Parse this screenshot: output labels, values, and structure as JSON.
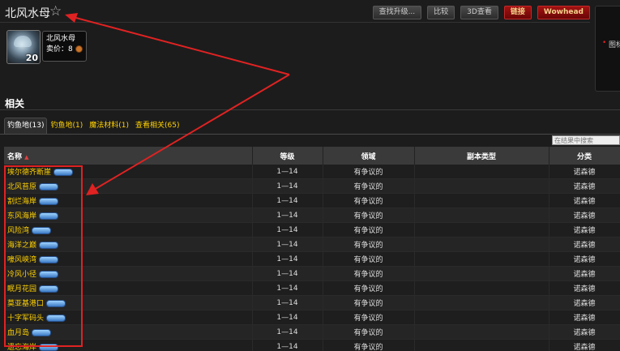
{
  "header": {
    "title": "北风水母",
    "toolbar": [
      {
        "label": "查找升级..."
      },
      {
        "label": "比较"
      },
      {
        "label": "3D查看"
      },
      {
        "label": "链接"
      },
      {
        "label": "Wowhead"
      }
    ]
  },
  "item": {
    "name": "北风水母",
    "count": "20",
    "price_label": "卖价：",
    "price_value": "8"
  },
  "side_panel": {
    "text": "图标"
  },
  "section": {
    "title": "相关",
    "tabs": [
      {
        "label": "钓鱼地(13)",
        "active": true
      },
      {
        "label": "钓鱼地(1)"
      },
      {
        "label": "魔法材料(1)"
      },
      {
        "label": "查看相关(65)"
      }
    ]
  },
  "search": {
    "placeholder": "在结果中搜索"
  },
  "table": {
    "columns": [
      "名称",
      "等级",
      "领域",
      "副本类型",
      "分类"
    ],
    "rows": [
      {
        "name": "埃尔德齐断崖",
        "level": "1—14",
        "realm": "有争议的",
        "instance": "",
        "category": "诺森德"
      },
      {
        "name": "北风苔原",
        "level": "1—14",
        "realm": "有争议的",
        "instance": "",
        "category": "诺森德"
      },
      {
        "name": "割烂海岸",
        "level": "1—14",
        "realm": "有争议的",
        "instance": "",
        "category": "诺森德"
      },
      {
        "name": "东风海岸",
        "level": "1—14",
        "realm": "有争议的",
        "instance": "",
        "category": "诺森德"
      },
      {
        "name": "风险湾",
        "level": "1—14",
        "realm": "有争议的",
        "instance": "",
        "category": "诺森德"
      },
      {
        "name": "海洋之巅",
        "level": "1—14",
        "realm": "有争议的",
        "instance": "",
        "category": "诺森德"
      },
      {
        "name": "嚎风峡湾",
        "level": "1—14",
        "realm": "有争议的",
        "instance": "",
        "category": "诺森德"
      },
      {
        "name": "冷风小径",
        "level": "1—14",
        "realm": "有争议的",
        "instance": "",
        "category": "诺森德"
      },
      {
        "name": "眠月花园",
        "level": "1—14",
        "realm": "有争议的",
        "instance": "",
        "category": "诺森德"
      },
      {
        "name": "莫亚基港口",
        "level": "1—14",
        "realm": "有争议的",
        "instance": "",
        "category": "诺森德"
      },
      {
        "name": "十字军码头",
        "level": "1—14",
        "realm": "有争议的",
        "instance": "",
        "category": "诺森德"
      },
      {
        "name": "血月岛",
        "level": "1—14",
        "realm": "有争议的",
        "instance": "",
        "category": "诺森德"
      },
      {
        "name": "遗忘海岸",
        "level": "1—14",
        "realm": "有争议的",
        "instance": "",
        "category": "诺森德"
      }
    ]
  },
  "colors": {
    "background": "#1c1c1c",
    "link_gold": "#ffd100",
    "annotation_red": "#e02222",
    "button_red": "#8e0e0e"
  }
}
